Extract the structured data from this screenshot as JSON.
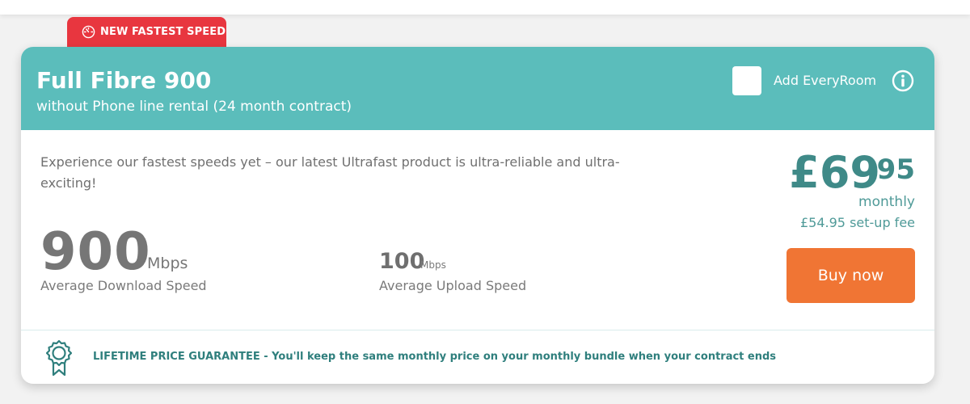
{
  "badge": {
    "label": "NEW FASTEST SPEED",
    "icon": "speedometer-icon",
    "color": "#e8363f"
  },
  "plan": {
    "title": "Full Fibre 900",
    "subtitle": "without Phone line rental (24 month contract)",
    "header_color": "#5bbdbb",
    "addon": {
      "label": "Add EveryRoom",
      "checked": false,
      "icon": "info-icon"
    },
    "description": "Experience our fastest speeds yet – our latest Ultrafast product is ultra-reliable and ultra-exciting!",
    "download": {
      "value": "900",
      "unit": "Mbps",
      "label": "Average Download Speed"
    },
    "upload": {
      "value": "100",
      "unit": "Mbps",
      "label": "Average Upload Speed"
    },
    "price": {
      "main": "£69",
      "pence": ".95",
      "period": "monthly",
      "setup_fee": "£54.95 set-up fee",
      "color": "#3f8a88"
    },
    "buy_label": "Buy now",
    "buy_color": "#f07534"
  },
  "guarantee": {
    "icon": "award-ribbon-icon",
    "text": "LIFETIME PRICE GUARANTEE - You'll keep the same monthly price on your monthly bundle when your contract ends"
  }
}
